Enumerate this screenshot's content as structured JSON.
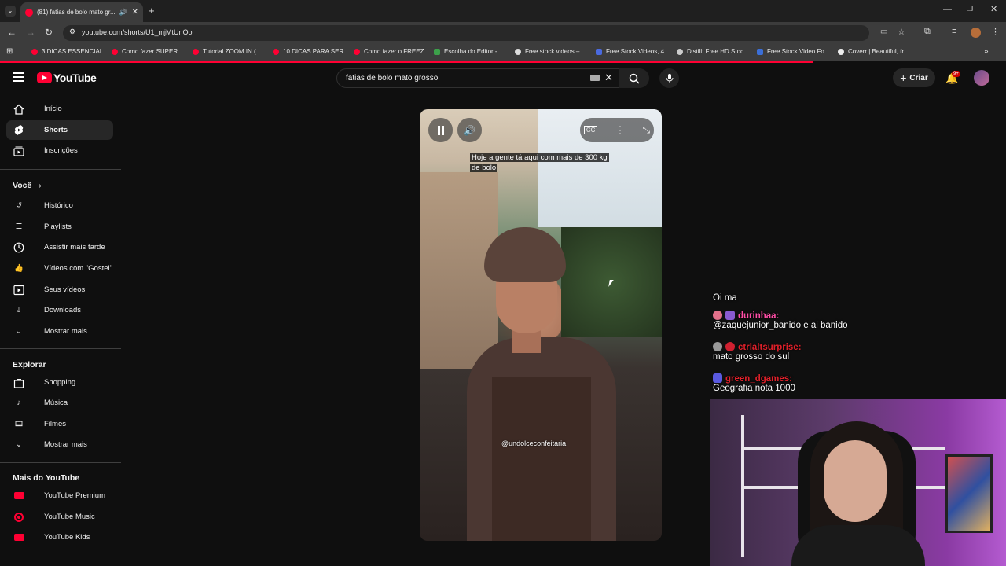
{
  "browser": {
    "tab_title": "(81) fatias de bolo mato gr...",
    "url": "youtube.com/shorts/U1_mjMtUnOo",
    "bookmarks": [
      "3 DICAS ESSENCIAI...",
      "Como fazer SUPER...",
      "Tutorial ZOOM IN (...",
      "10 DICAS PARA SER...",
      "Como fazer o FREEZ...",
      "Escolha do Editor -...",
      "Free stock videos –...",
      "Free Stock Videos, 4...",
      "Distill: Free HD Stoc...",
      "Free Stock Video Fo...",
      "Coverr | Beautiful, fr..."
    ]
  },
  "header": {
    "logo": "YouTube",
    "search_value": "fatias de bolo mato grosso",
    "create_label": "Criar",
    "notifications": "9+"
  },
  "sidebar": {
    "main": [
      {
        "label": "Início",
        "icon": "home-icon"
      },
      {
        "label": "Shorts",
        "icon": "shorts-icon"
      },
      {
        "label": "Inscrições",
        "icon": "subscriptions-icon"
      }
    ],
    "you_title": "Você",
    "you": [
      {
        "label": "Histórico",
        "icon": "history-icon"
      },
      {
        "label": "Playlists",
        "icon": "playlists-icon"
      },
      {
        "label": "Assistir mais tarde",
        "icon": "clock-icon"
      },
      {
        "label": "Vídeos com \"Gostei\"",
        "icon": "like-icon"
      },
      {
        "label": "Seus vídeos",
        "icon": "video-icon"
      },
      {
        "label": "Downloads",
        "icon": "download-icon"
      },
      {
        "label": "Mostrar mais",
        "icon": "chevron-down-icon"
      }
    ],
    "explore_title": "Explorar",
    "explore": [
      {
        "label": "Shopping",
        "icon": "bag-icon"
      },
      {
        "label": "Música",
        "icon": "music-icon"
      },
      {
        "label": "Filmes",
        "icon": "film-icon"
      },
      {
        "label": "Mostrar mais",
        "icon": "chevron-down-icon"
      }
    ],
    "more_title": "Mais do YouTube",
    "more": [
      {
        "label": "YouTube Premium",
        "icon": "yt-premium-icon"
      },
      {
        "label": "YouTube Music",
        "icon": "yt-music-icon"
      },
      {
        "label": "YouTube Kids",
        "icon": "yt-kids-icon"
      }
    ]
  },
  "video": {
    "caption_line1": "Hoje a gente tá aqui com mais de 300 kg",
    "caption_line2": "de bolo",
    "watermark": "@undolceconfeitaria"
  },
  "chat": {
    "lines": [
      {
        "user": "",
        "text": "Oi ma"
      },
      {
        "user": "durinhaa:",
        "text": "@zaquejunior_banido e ai banido",
        "color": "#ff4da6"
      },
      {
        "user": "ctrlaltsurprise:",
        "text": "mato grosso do sul",
        "color": "#e0202a"
      },
      {
        "user": "green_dgames:",
        "text": "Geografia nota 1000",
        "color": "#e0202a"
      }
    ]
  },
  "colors": {
    "accent": "#ff0033",
    "background": "#0f0f0f"
  }
}
